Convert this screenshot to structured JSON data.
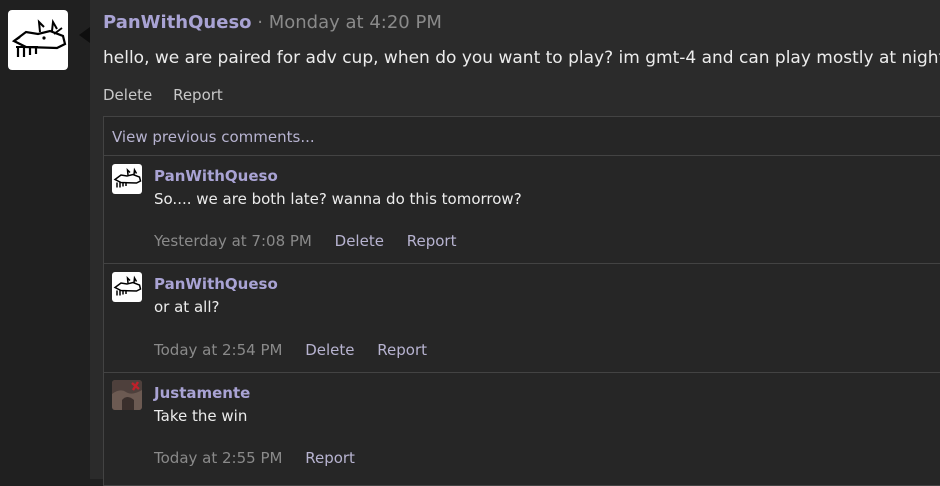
{
  "post": {
    "author": "PanWithQueso",
    "separator": "·",
    "timestamp": "Monday at 4:20 PM",
    "body": "hello, we are paired for adv cup, when do you want to play? im gmt-4 and can play mostly at nights.",
    "actions": {
      "delete": "Delete",
      "report": "Report"
    }
  },
  "comments": {
    "view_previous": "View previous comments...",
    "items": [
      {
        "author": "PanWithQueso",
        "text": "So.... we are both late? wanna do this tomorrow?",
        "time": "Yesterday at 7:08 PM",
        "delete": "Delete",
        "report": "Report"
      },
      {
        "author": "PanWithQueso",
        "text": "or at all?",
        "time": "Today at 2:54 PM",
        "delete": "Delete",
        "report": "Report"
      },
      {
        "author": "Justamente",
        "text": "Take the win",
        "time": "Today at 2:55 PM",
        "report": "Report"
      }
    ]
  },
  "colors": {
    "author": "#a9a3d4",
    "link": "#b7b3d0",
    "meta": "#8a8a8a",
    "text": "#ececec",
    "panel": "#2b2b2b",
    "background": "#202020"
  },
  "icons": {
    "main_avatar": "rat-drawing-avatar",
    "comment_avatar_2": "dark-photo-avatar"
  }
}
